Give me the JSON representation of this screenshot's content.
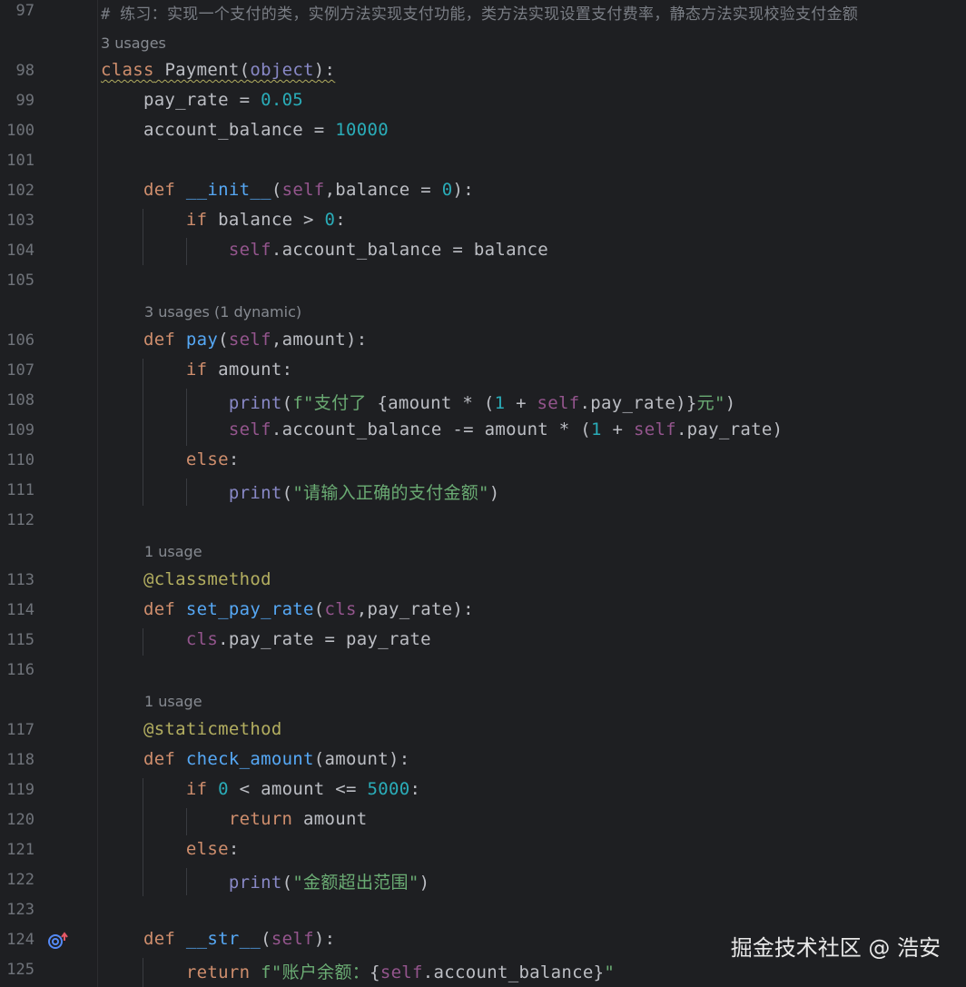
{
  "editor": {
    "line_numbers": [
      "97",
      "98",
      "99",
      "100",
      "101",
      "102",
      "103",
      "104",
      "105",
      "106",
      "107",
      "108",
      "109",
      "110",
      "111",
      "112",
      "113",
      "114",
      "115",
      "116",
      "117",
      "118",
      "119",
      "120",
      "121",
      "122",
      "123",
      "124",
      "125"
    ],
    "hints": {
      "h98": "3 usages",
      "h106": "3 usages (1 dynamic)",
      "h113": "1 usage",
      "h117": "1 usage"
    },
    "lines": {
      "l97_comment": "# 练习：实现一个支付的类，实例方法实现支付功能，类方法实现设置支付费率，静态方法实现校验支付金额",
      "l98_kw": "class",
      "l98_name": " Payment(",
      "l98_obj": "object",
      "l98_end": "):",
      "l99_a": "    pay_rate = ",
      "l99_num": "0.05",
      "l100_a": "    account_balance = ",
      "l100_num": "10000",
      "l102_kw": "    def ",
      "l102_fn": "__init__",
      "l102_p1": "(",
      "l102_self": "self",
      "l102_p2": ",balance = ",
      "l102_num": "0",
      "l102_end": "):",
      "l103_kw": "        if",
      "l103_a": " balance > ",
      "l103_num": "0",
      "l103_end": ":",
      "l104_self": "            self",
      "l104_a": ".account_balance = balance",
      "l106_kw": "    def ",
      "l106_fn": "pay",
      "l106_p1": "(",
      "l106_self": "self",
      "l106_p2": ",amount):",
      "l107_kw": "        if",
      "l107_a": " amount:",
      "l108_print": "            print",
      "l108_a": "(",
      "l108_f": "f\"支付了 ",
      "l108_b": "{amount * (",
      "l108_num": "1",
      "l108_c": " + ",
      "l108_self": "self",
      "l108_d": ".pay_rate)}",
      "l108_s2": "元\"",
      "l108_end": ")",
      "l109_self": "            self",
      "l109_a": ".account_balance -= amount * (",
      "l109_num": "1",
      "l109_b": " + ",
      "l109_self2": "self",
      "l109_c": ".pay_rate)",
      "l110_kw": "        else",
      "l110_end": ":",
      "l111_print": "            print",
      "l111_a": "(",
      "l111_s": "\"请输入正确的支付金额\"",
      "l111_end": ")",
      "l113_deco": "    @classmethod",
      "l114_kw": "    def ",
      "l114_fn": "set_pay_rate",
      "l114_p1": "(",
      "l114_cls": "cls",
      "l114_p2": ",pay_rate):",
      "l115_cls": "        cls",
      "l115_a": ".pay_rate = pay_rate",
      "l117_deco": "    @staticmethod",
      "l118_kw": "    def ",
      "l118_fn": "check_amount",
      "l118_p": "(amount):",
      "l119_kw": "        if ",
      "l119_num": "0",
      "l119_a": " < amount <= ",
      "l119_num2": "5000",
      "l119_end": ":",
      "l120_kw": "            return",
      "l120_a": " amount",
      "l121_kw": "        else",
      "l121_end": ":",
      "l122_print": "            print",
      "l122_a": "(",
      "l122_s": "\"金额超出范围\"",
      "l122_end": ")",
      "l124_kw": "    def ",
      "l124_fn": "__str__",
      "l124_p1": "(",
      "l124_self": "self",
      "l124_end": "):",
      "l125_kw": "        return",
      "l125_f": " f\"账户余额：",
      "l125_b": "{",
      "l125_self": "self",
      "l125_c": ".account_balance}",
      "l125_s2": "\""
    }
  },
  "watermark": "掘金技术社区 @ 浩安",
  "icons": {
    "override_marker": "override-up-arrow-icon"
  },
  "colors": {
    "background": "#1e1f22",
    "keyword": "#cf8e6d",
    "function": "#56a8f5",
    "self": "#94558d",
    "number": "#2aacb8",
    "string": "#6aab73",
    "comment": "#7a7e85",
    "decorator": "#b3ae60"
  }
}
